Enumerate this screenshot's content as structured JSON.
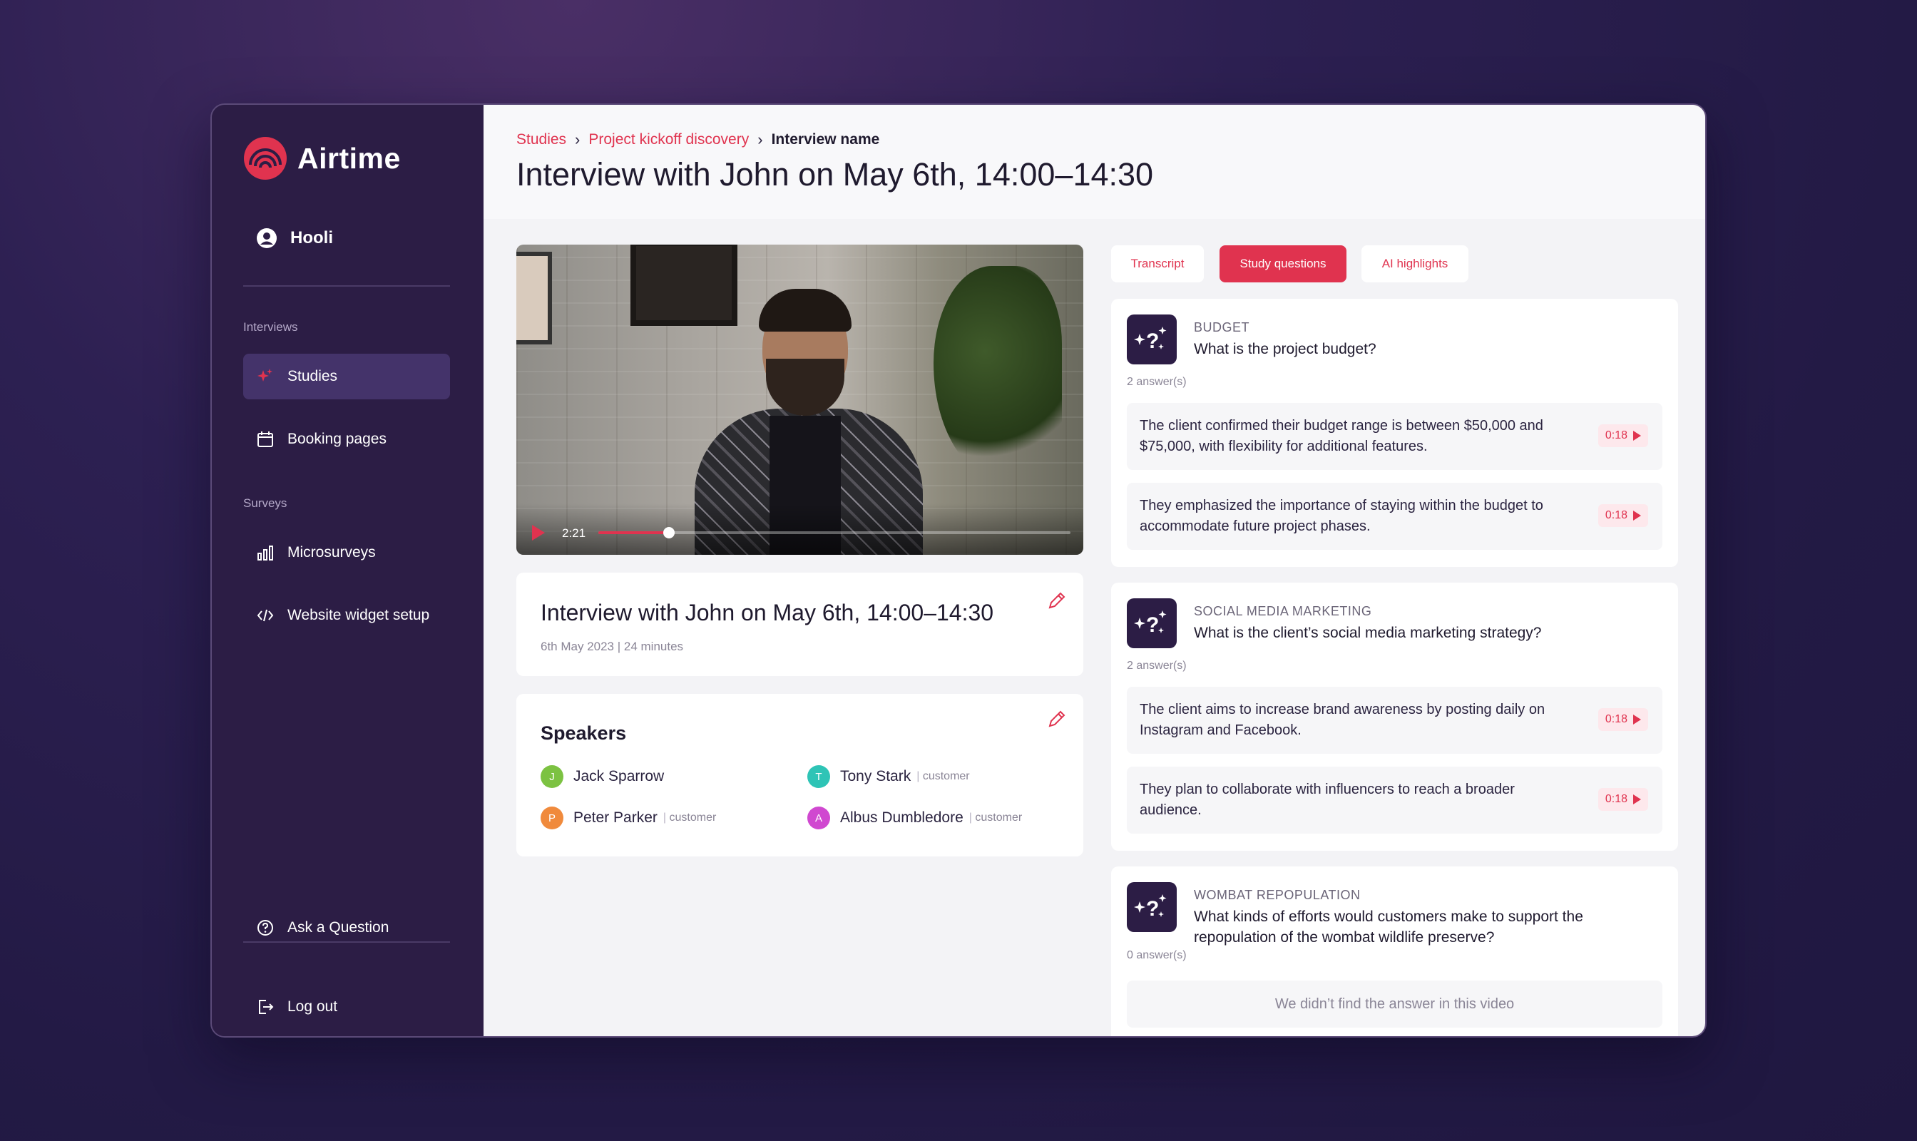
{
  "app": {
    "name": "Airtime",
    "org": "Hooli"
  },
  "sidebar": {
    "section_interviews": "Interviews",
    "section_surveys": "Surveys",
    "items": [
      {
        "label": "Studies",
        "icon": "sparkle-icon"
      },
      {
        "label": "Booking pages",
        "icon": "calendar-icon"
      },
      {
        "label": "Microsurveys",
        "icon": "bar-chart-icon"
      },
      {
        "label": "Website widget setup",
        "icon": "code-icon"
      }
    ],
    "ask": "Ask a Question",
    "logout": "Log out"
  },
  "breadcrumb": {
    "studies": "Studies",
    "study": "Project kickoff discovery",
    "current": "Interview name"
  },
  "page_title": "Interview with John on May 6th, 14:00–14:30",
  "video": {
    "time": "2:21",
    "progress": 0.15
  },
  "interview": {
    "title": "Interview with John on May 6th, 14:00–14:30",
    "meta": "6th May 2023 |  24 minutes"
  },
  "speakers": {
    "title": "Speakers",
    "list": [
      {
        "initial": "J",
        "name": "Jack Sparrow",
        "role": "",
        "color": "#7cc242"
      },
      {
        "initial": "T",
        "name": "Tony Stark",
        "role": "customer",
        "color": "#2ec4b6"
      },
      {
        "initial": "P",
        "name": "Peter Parker",
        "role": "customer",
        "color": "#f08a3c"
      },
      {
        "initial": "A",
        "name": "Albus Dumbledore",
        "role": "customer",
        "color": "#d048d0"
      }
    ]
  },
  "tabs": [
    "Transcript",
    "Study questions",
    "AI highlights"
  ],
  "questions": [
    {
      "category": "BUDGET",
      "question": "What is the project budget?",
      "count": "2 answer(s)",
      "answers": [
        {
          "text": "The client confirmed their budget range is between $50,000 and $75,000, with flexibility for additional features.",
          "time": "0:18"
        },
        {
          "text": "They emphasized the importance of staying within the budget to accommodate future project phases.",
          "time": "0:18"
        }
      ]
    },
    {
      "category": "SOCIAL MEDIA MARKETING",
      "question": "What is the client’s social media marketing strategy?",
      "count": "2 answer(s)",
      "answers": [
        {
          "text": "The client aims to increase brand awareness by posting daily on Instagram and Facebook.",
          "time": "0:18"
        },
        {
          "text": "They plan to collaborate with influencers to reach a broader audience.",
          "time": "0:18"
        }
      ]
    },
    {
      "category": "WOMBAT REPOPULATION",
      "question": "What kinds of efforts would customers make to support the repopulation of the wombat wildlife preserve?",
      "count": "0 answer(s)",
      "no_answer": "We didn’t find the answer in this video"
    }
  ],
  "colors": {
    "accent": "#e0334f",
    "sidebar": "#2c1d45",
    "active_nav": "#44336a"
  }
}
